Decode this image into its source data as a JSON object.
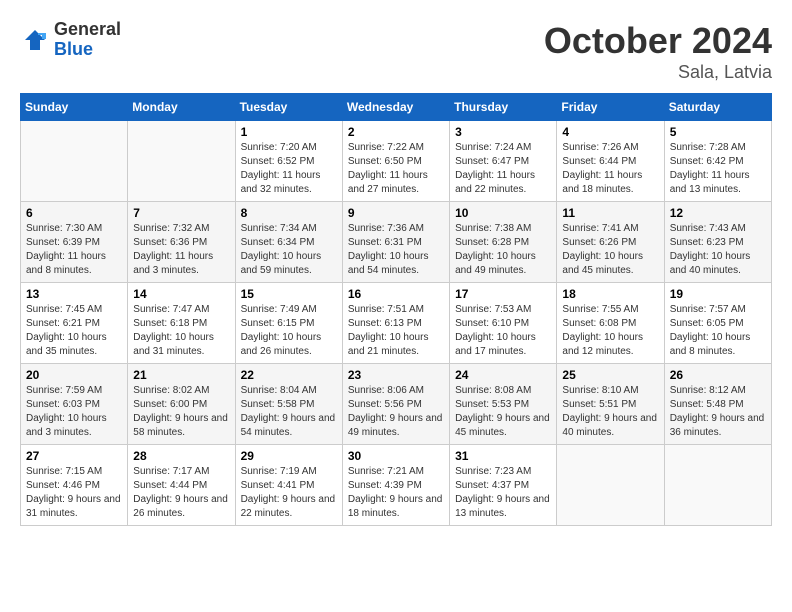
{
  "logo": {
    "general": "General",
    "blue": "Blue"
  },
  "header": {
    "month": "October 2024",
    "location": "Sala, Latvia"
  },
  "weekdays": [
    "Sunday",
    "Monday",
    "Tuesday",
    "Wednesday",
    "Thursday",
    "Friday",
    "Saturday"
  ],
  "weeks": [
    [
      {
        "day": "",
        "sunrise": "",
        "sunset": "",
        "daylight": ""
      },
      {
        "day": "",
        "sunrise": "",
        "sunset": "",
        "daylight": ""
      },
      {
        "day": "1",
        "sunrise": "Sunrise: 7:20 AM",
        "sunset": "Sunset: 6:52 PM",
        "daylight": "Daylight: 11 hours and 32 minutes."
      },
      {
        "day": "2",
        "sunrise": "Sunrise: 7:22 AM",
        "sunset": "Sunset: 6:50 PM",
        "daylight": "Daylight: 11 hours and 27 minutes."
      },
      {
        "day": "3",
        "sunrise": "Sunrise: 7:24 AM",
        "sunset": "Sunset: 6:47 PM",
        "daylight": "Daylight: 11 hours and 22 minutes."
      },
      {
        "day": "4",
        "sunrise": "Sunrise: 7:26 AM",
        "sunset": "Sunset: 6:44 PM",
        "daylight": "Daylight: 11 hours and 18 minutes."
      },
      {
        "day": "5",
        "sunrise": "Sunrise: 7:28 AM",
        "sunset": "Sunset: 6:42 PM",
        "daylight": "Daylight: 11 hours and 13 minutes."
      }
    ],
    [
      {
        "day": "6",
        "sunrise": "Sunrise: 7:30 AM",
        "sunset": "Sunset: 6:39 PM",
        "daylight": "Daylight: 11 hours and 8 minutes."
      },
      {
        "day": "7",
        "sunrise": "Sunrise: 7:32 AM",
        "sunset": "Sunset: 6:36 PM",
        "daylight": "Daylight: 11 hours and 3 minutes."
      },
      {
        "day": "8",
        "sunrise": "Sunrise: 7:34 AM",
        "sunset": "Sunset: 6:34 PM",
        "daylight": "Daylight: 10 hours and 59 minutes."
      },
      {
        "day": "9",
        "sunrise": "Sunrise: 7:36 AM",
        "sunset": "Sunset: 6:31 PM",
        "daylight": "Daylight: 10 hours and 54 minutes."
      },
      {
        "day": "10",
        "sunrise": "Sunrise: 7:38 AM",
        "sunset": "Sunset: 6:28 PM",
        "daylight": "Daylight: 10 hours and 49 minutes."
      },
      {
        "day": "11",
        "sunrise": "Sunrise: 7:41 AM",
        "sunset": "Sunset: 6:26 PM",
        "daylight": "Daylight: 10 hours and 45 minutes."
      },
      {
        "day": "12",
        "sunrise": "Sunrise: 7:43 AM",
        "sunset": "Sunset: 6:23 PM",
        "daylight": "Daylight: 10 hours and 40 minutes."
      }
    ],
    [
      {
        "day": "13",
        "sunrise": "Sunrise: 7:45 AM",
        "sunset": "Sunset: 6:21 PM",
        "daylight": "Daylight: 10 hours and 35 minutes."
      },
      {
        "day": "14",
        "sunrise": "Sunrise: 7:47 AM",
        "sunset": "Sunset: 6:18 PM",
        "daylight": "Daylight: 10 hours and 31 minutes."
      },
      {
        "day": "15",
        "sunrise": "Sunrise: 7:49 AM",
        "sunset": "Sunset: 6:15 PM",
        "daylight": "Daylight: 10 hours and 26 minutes."
      },
      {
        "day": "16",
        "sunrise": "Sunrise: 7:51 AM",
        "sunset": "Sunset: 6:13 PM",
        "daylight": "Daylight: 10 hours and 21 minutes."
      },
      {
        "day": "17",
        "sunrise": "Sunrise: 7:53 AM",
        "sunset": "Sunset: 6:10 PM",
        "daylight": "Daylight: 10 hours and 17 minutes."
      },
      {
        "day": "18",
        "sunrise": "Sunrise: 7:55 AM",
        "sunset": "Sunset: 6:08 PM",
        "daylight": "Daylight: 10 hours and 12 minutes."
      },
      {
        "day": "19",
        "sunrise": "Sunrise: 7:57 AM",
        "sunset": "Sunset: 6:05 PM",
        "daylight": "Daylight: 10 hours and 8 minutes."
      }
    ],
    [
      {
        "day": "20",
        "sunrise": "Sunrise: 7:59 AM",
        "sunset": "Sunset: 6:03 PM",
        "daylight": "Daylight: 10 hours and 3 minutes."
      },
      {
        "day": "21",
        "sunrise": "Sunrise: 8:02 AM",
        "sunset": "Sunset: 6:00 PM",
        "daylight": "Daylight: 9 hours and 58 minutes."
      },
      {
        "day": "22",
        "sunrise": "Sunrise: 8:04 AM",
        "sunset": "Sunset: 5:58 PM",
        "daylight": "Daylight: 9 hours and 54 minutes."
      },
      {
        "day": "23",
        "sunrise": "Sunrise: 8:06 AM",
        "sunset": "Sunset: 5:56 PM",
        "daylight": "Daylight: 9 hours and 49 minutes."
      },
      {
        "day": "24",
        "sunrise": "Sunrise: 8:08 AM",
        "sunset": "Sunset: 5:53 PM",
        "daylight": "Daylight: 9 hours and 45 minutes."
      },
      {
        "day": "25",
        "sunrise": "Sunrise: 8:10 AM",
        "sunset": "Sunset: 5:51 PM",
        "daylight": "Daylight: 9 hours and 40 minutes."
      },
      {
        "day": "26",
        "sunrise": "Sunrise: 8:12 AM",
        "sunset": "Sunset: 5:48 PM",
        "daylight": "Daylight: 9 hours and 36 minutes."
      }
    ],
    [
      {
        "day": "27",
        "sunrise": "Sunrise: 7:15 AM",
        "sunset": "Sunset: 4:46 PM",
        "daylight": "Daylight: 9 hours and 31 minutes."
      },
      {
        "day": "28",
        "sunrise": "Sunrise: 7:17 AM",
        "sunset": "Sunset: 4:44 PM",
        "daylight": "Daylight: 9 hours and 26 minutes."
      },
      {
        "day": "29",
        "sunrise": "Sunrise: 7:19 AM",
        "sunset": "Sunset: 4:41 PM",
        "daylight": "Daylight: 9 hours and 22 minutes."
      },
      {
        "day": "30",
        "sunrise": "Sunrise: 7:21 AM",
        "sunset": "Sunset: 4:39 PM",
        "daylight": "Daylight: 9 hours and 18 minutes."
      },
      {
        "day": "31",
        "sunrise": "Sunrise: 7:23 AM",
        "sunset": "Sunset: 4:37 PM",
        "daylight": "Daylight: 9 hours and 13 minutes."
      },
      {
        "day": "",
        "sunrise": "",
        "sunset": "",
        "daylight": ""
      },
      {
        "day": "",
        "sunrise": "",
        "sunset": "",
        "daylight": ""
      }
    ]
  ]
}
